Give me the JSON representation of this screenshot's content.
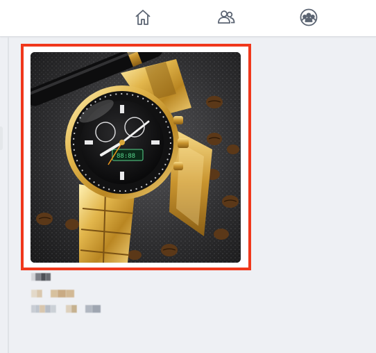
{
  "nav": {
    "items": [
      {
        "name": "home-icon"
      },
      {
        "name": "friends-icon"
      },
      {
        "name": "groups-icon"
      }
    ]
  },
  "product": {
    "image": "gold-chronograph-watch-photo",
    "image_alt": ""
  },
  "colors": {
    "highlight_border": "#f0381c",
    "background": "#eef0f4",
    "icon": "#5b6472"
  }
}
